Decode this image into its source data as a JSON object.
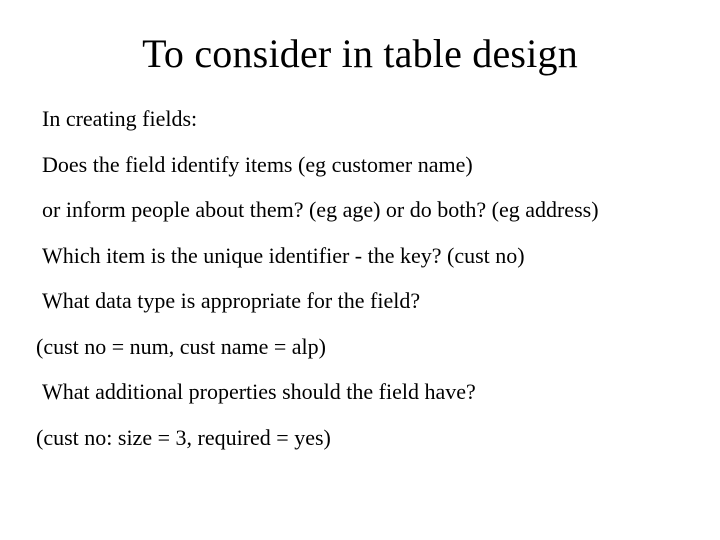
{
  "title": "To consider in table design",
  "lines": [
    "In creating fields:",
    "Does the field identify items (eg customer name)",
    "or inform people about them? (eg age) or do both? (eg address)",
    "Which item is the unique identifier - the key? (cust no)",
    "What data type is appropriate for the field?",
    "(cust no = num, cust name = alp)",
    "What additional properties should the field have?",
    "(cust no: size = 3, required = yes)"
  ]
}
